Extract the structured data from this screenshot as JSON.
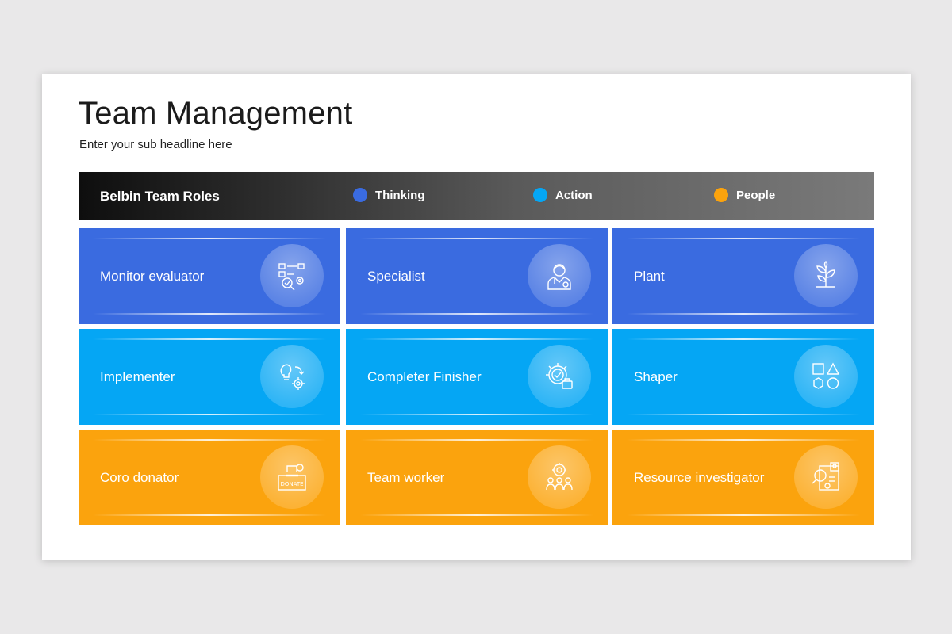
{
  "title": "Team Management",
  "subtitle": "Enter your sub headline here",
  "header": {
    "title": "Belbin Team Roles",
    "legend": [
      {
        "label": "Thinking",
        "color": "#3a6be0"
      },
      {
        "label": "Action",
        "color": "#05a6f4"
      },
      {
        "label": "People",
        "color": "#fba30d"
      }
    ]
  },
  "roles": [
    {
      "label": "Monitor evaluator",
      "icon": "checklist-magnifier-icon",
      "category": "Thinking"
    },
    {
      "label": "Specialist",
      "icon": "doctor-icon",
      "category": "Thinking"
    },
    {
      "label": "Plant",
      "icon": "plant-icon",
      "category": "Thinking"
    },
    {
      "label": "Implementer",
      "icon": "idea-gear-icon",
      "category": "Action"
    },
    {
      "label": "Completer Finisher",
      "icon": "gear-check-icon",
      "category": "Action"
    },
    {
      "label": "Shaper",
      "icon": "shapes-icon",
      "category": "Action"
    },
    {
      "label": "Coro donator",
      "icon": "donate-box-icon",
      "category": "People"
    },
    {
      "label": "Team worker",
      "icon": "team-gear-icon",
      "category": "People"
    },
    {
      "label": "Resource investigator",
      "icon": "resource-search-icon",
      "category": "People"
    }
  ],
  "colors": {
    "thinking": "#3a6be0",
    "action": "#05a6f4",
    "people": "#fba30d"
  }
}
